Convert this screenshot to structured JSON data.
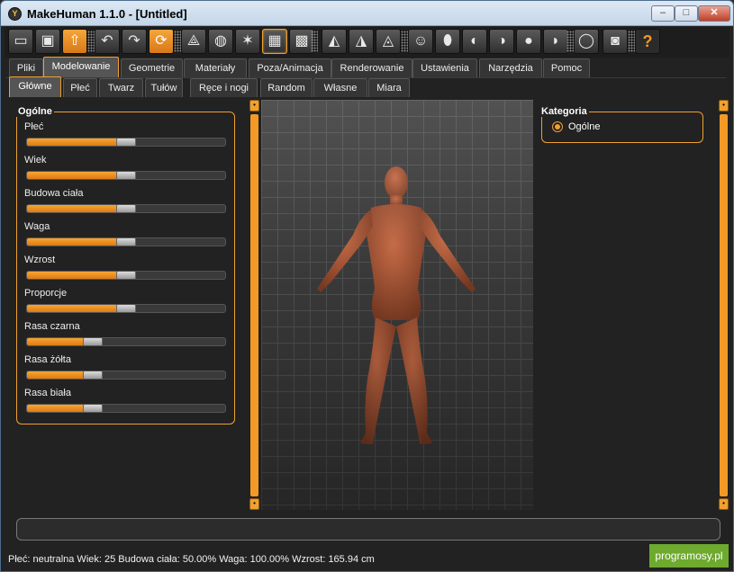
{
  "window": {
    "title": "MakeHuman 1.1.0 - [Untitled]",
    "app_icon": "Y",
    "min_label": "–",
    "max_label": "□",
    "close_label": "✕"
  },
  "toolbar": [
    {
      "name": "undo-save-pill",
      "glyph": "▭"
    },
    {
      "name": "save-icon",
      "glyph": "▣"
    },
    {
      "name": "export-icon",
      "glyph": "⇧",
      "style": "orange"
    },
    {
      "name": "undo-icon",
      "glyph": "↶"
    },
    {
      "name": "redo-icon",
      "glyph": "↷"
    },
    {
      "name": "reset-icon",
      "glyph": "⟳",
      "style": "orange"
    },
    {
      "name": "smooth-icon",
      "glyph": "⟁"
    },
    {
      "name": "wireframe-icon",
      "glyph": "◍"
    },
    {
      "name": "pose-icon",
      "glyph": "✶"
    },
    {
      "name": "grid-icon",
      "glyph": "▦",
      "style": "sel"
    },
    {
      "name": "checker-icon",
      "glyph": "▩"
    },
    {
      "name": "symmetry-right-icon",
      "glyph": "◭"
    },
    {
      "name": "symmetry-left-icon",
      "glyph": "◮"
    },
    {
      "name": "symmetry-icon",
      "glyph": "◬"
    },
    {
      "name": "front-view-icon",
      "glyph": "☺"
    },
    {
      "name": "back-view-icon",
      "glyph": "⬮"
    },
    {
      "name": "left-view-icon",
      "glyph": "◐"
    },
    {
      "name": "right-view-icon",
      "glyph": "◑"
    },
    {
      "name": "top-view-icon",
      "glyph": "●"
    },
    {
      "name": "bottom-view-icon",
      "glyph": "◗"
    },
    {
      "name": "reset-camera-icon",
      "glyph": "◯"
    },
    {
      "name": "screenshot-icon",
      "glyph": "◙"
    },
    {
      "name": "help-icon",
      "glyph": "?",
      "style": "help"
    }
  ],
  "main_tabs": [
    {
      "label": "Pliki"
    },
    {
      "label": "Modelowanie",
      "active": true
    },
    {
      "label": "Geometrie"
    },
    {
      "label": "Materiały"
    },
    {
      "label": "Poza/Animacja"
    },
    {
      "label": "Renderowanie"
    },
    {
      "label": "Ustawienia"
    },
    {
      "label": "Narzędzia"
    },
    {
      "label": "Pomoc"
    }
  ],
  "sub_tabs": [
    {
      "label": "Główne",
      "active": true
    },
    {
      "label": "Płeć"
    },
    {
      "label": "Twarz"
    },
    {
      "label": "Tułów"
    },
    {
      "label": "Ręce i nogi"
    },
    {
      "label": "Random"
    },
    {
      "label": "Własne"
    },
    {
      "label": "Miara"
    }
  ],
  "left_panel": {
    "title": "Ogólne",
    "sliders": [
      {
        "label": "Płeć",
        "value": 0.5
      },
      {
        "label": "Wiek",
        "value": 0.5
      },
      {
        "label": "Budowa ciała",
        "value": 0.5
      },
      {
        "label": "Waga",
        "value": 0.5
      },
      {
        "label": "Wzrost",
        "value": 0.5
      },
      {
        "label": "Proporcje",
        "value": 0.5
      },
      {
        "label": "Rasa czarna",
        "value": 0.333
      },
      {
        "label": "Rasa żółta",
        "value": 0.333
      },
      {
        "label": "Rasa biała",
        "value": 0.333
      }
    ]
  },
  "right_panel": {
    "title": "Kategoria",
    "options": [
      {
        "label": "Ogólne",
        "selected": true
      }
    ]
  },
  "status": {
    "text": "Płeć: neutralna Wiek: 25 Budowa ciała: 50.00% Waga: 100.00% Wzrost: 165.94 cm"
  },
  "watermark": "programosy.pl",
  "colors": {
    "accent": "#f0a030",
    "skin": "#a85a3a"
  }
}
